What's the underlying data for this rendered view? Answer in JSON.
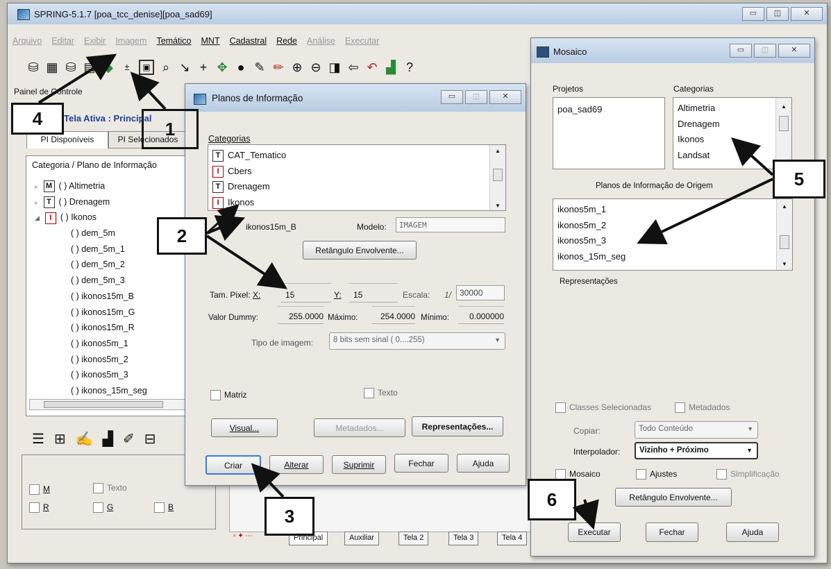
{
  "main_window": {
    "title": "SPRING-5.1.7 [poa_tcc_denise][poa_sad69]",
    "menu": [
      {
        "label": "Arquivo",
        "enabled": false
      },
      {
        "label": "Editar",
        "enabled": false
      },
      {
        "label": "Exibir",
        "enabled": false
      },
      {
        "label": "Imagem",
        "enabled": false
      },
      {
        "label": "Temático",
        "enabled": true
      },
      {
        "label": "MNT",
        "enabled": true
      },
      {
        "label": "Cadastral",
        "enabled": true
      },
      {
        "label": "Rede",
        "enabled": true
      },
      {
        "label": "Análise",
        "enabled": false
      },
      {
        "label": "Executar",
        "enabled": false
      }
    ],
    "toolbar_icons": [
      "database-icon",
      "grid-icon",
      "database-icon",
      "table-icon",
      "layer-icon",
      "plus-minus-icon",
      "image-icon",
      "search-icon",
      "cursor-icon",
      "plus-icon",
      "pan-icon",
      "info-icon",
      "measure-icon",
      "pencil-icon",
      "zoom-in-icon",
      "zoom-out-icon",
      "zoom-area-icon",
      "back-icon",
      "undo-icon",
      "palette-icon",
      "help-icon"
    ],
    "panel_title": "Painel de Controle",
    "active_screen": "Tela Ativa : Principal",
    "tabs": [
      "PI Disponíveis",
      "PI Selecionados"
    ],
    "tree_header": "Categoria / Plano de Informação",
    "tree": [
      {
        "type": "M",
        "label": "( ) Altimetria",
        "expander": "▹",
        "indent": 0
      },
      {
        "type": "T",
        "label": "( ) Drenagem",
        "expander": "▹",
        "indent": 0
      },
      {
        "type": "I",
        "label": "( ) Ikonos",
        "expander": "◢",
        "indent": 0
      },
      {
        "label": "( ) dem_5m",
        "indent": 1
      },
      {
        "label": "( ) dem_5m_1",
        "indent": 1
      },
      {
        "label": "( ) dem_5m_2",
        "indent": 1
      },
      {
        "label": "( ) dem_5m_3",
        "indent": 1
      },
      {
        "label": "( ) ikonos15m_B",
        "indent": 1
      },
      {
        "label": "( ) ikonos15m_G",
        "indent": 1
      },
      {
        "label": "( ) ikonos15m_R",
        "indent": 1
      },
      {
        "label": "( ) ikonos5m_1",
        "indent": 1
      },
      {
        "label": "( ) ikonos5m_2",
        "indent": 1
      },
      {
        "label": "( ) ikonos5m_3",
        "indent": 1
      },
      {
        "label": "( ) ikonos_15m_seg",
        "indent": 1
      }
    ],
    "bottom_checks": {
      "m": "M",
      "texto": "Texto",
      "r": "R",
      "g": "G",
      "b": "B"
    },
    "screen_tabs": [
      "Principal",
      "Auxiliar",
      "Tela 2",
      "Tela 3",
      "Tela 4"
    ]
  },
  "planos_dialog": {
    "title": "Planos de Informação",
    "categories_label": "Categorias",
    "categories": [
      {
        "type": "T",
        "label": "CAT_Tematico"
      },
      {
        "type": "I",
        "label": "Cbers"
      },
      {
        "type": "T",
        "label": "Drenagem"
      },
      {
        "type": "I",
        "label": "Ikonos"
      }
    ],
    "name_value": "ikonos15m_B",
    "modelo_label": "Modelo:",
    "modelo_value": "IMAGEM",
    "bbox_button": "Retângulo Envolvente...",
    "tam_pixel_label": "Tam. Pixel:",
    "x_label": "X:",
    "x_value": "15",
    "y_label": "Y:",
    "y_value": "15",
    "escala_label": "Escala:",
    "escala_prefix": "1/",
    "escala_value": "30000",
    "dummy_label": "Valor Dummy:",
    "dummy_value": "255.0000",
    "max_label": "Máximo:",
    "max_value": "254.0000",
    "min_label": "Mínimo:",
    "min_value": "0.000000",
    "tipo_label": "Tipo de imagem:",
    "tipo_value": "8 bits sem sinal ( 0....255)",
    "matriz_label": "Matriz",
    "texto_label": "Texto",
    "visual_button": "Visual...",
    "metadados_button": "Metadados...",
    "representacoes_button": "Representações...",
    "criar_button": "Criar",
    "alterar_button": "Alterar",
    "suprimir_button": "Suprimir",
    "fechar_button": "Fechar",
    "ajuda_button": "Ajuda"
  },
  "mosaico_dialog": {
    "title": "Mosaico",
    "projetos_label": "Projetos",
    "projetos": [
      "poa_sad69"
    ],
    "categorias_label": "Categorias",
    "categorias": [
      "Altimetria",
      "Drenagem",
      "Ikonos",
      "Landsat"
    ],
    "origem_label": "Planos de Informação de Origem",
    "origem": [
      "ikonos5m_1",
      "ikonos5m_2",
      "ikonos5m_3",
      "ikonos_15m_seg"
    ],
    "representacoes_label": "Representações",
    "classes_label": "Classes Selecionadas",
    "metadados_label": "Metadados",
    "copiar_label": "Copiar:",
    "copiar_value": "Todo Conteúdo",
    "interpolador_label": "Interpolador:",
    "interpolador_value": "Vizinho + Próximo",
    "mosaico_label": "Mosaico",
    "ajustes_label": "Ajustes",
    "simplificacao_label": "Simplificação",
    "bbox_button": "Retângulo Envolvente...",
    "executar_button": "Executar",
    "fechar_button": "Fechar",
    "ajuda_button": "Ajuda"
  },
  "callouts": [
    "1",
    "2",
    "3",
    "4",
    "5",
    "6"
  ],
  "colors": {
    "titlebar": "#c6d6ea",
    "link_blue": "#1f3f9a",
    "dialog_bg": "#ece9e3"
  }
}
